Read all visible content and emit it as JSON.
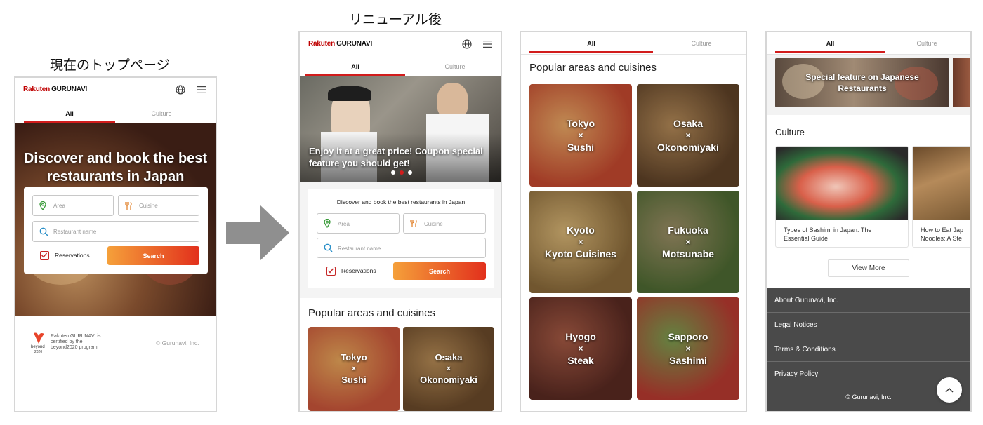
{
  "captions": {
    "current": "現在のトップページ",
    "renewal": "リニューアル後"
  },
  "header": {
    "logo_brand": "Rakuten",
    "logo_product": "GURUNAVI"
  },
  "tabs": {
    "all": "All",
    "culture": "Culture"
  },
  "screen1": {
    "hero_title_line1": "Discover and book the best",
    "hero_title_line2": "restaurants in Japan",
    "area_placeholder": "Area",
    "cuisine_placeholder": "Cuisine",
    "restaurant_placeholder": "Restaurant name",
    "reservations_label": "Reservations",
    "search_label": "Search",
    "footer_text_line1": "Rakuten GURUNAVI is",
    "footer_text_line2": "certified by the",
    "footer_text_line3": "beyond2020 program.",
    "beyond_logo_line1": "beyond",
    "beyond_logo_line2": "2020",
    "copyright": "© Gurunavi, Inc."
  },
  "screen2": {
    "banner_line1": "Enjoy it at a great price! Coupon special",
    "banner_line2": "feature you should get!",
    "search_heading": "Discover and book the best restaurants in Japan",
    "area_placeholder": "Area",
    "cuisine_placeholder": "Cuisine",
    "restaurant_placeholder": "Restaurant name",
    "reservations_label": "Reservations",
    "search_label": "Search",
    "popular_title": "Popular areas and cuisines",
    "tiles": [
      {
        "city": "Tokyo",
        "sep": "×",
        "food": "Sushi",
        "color1": "#c9553a",
        "color2": "#e8a65a"
      },
      {
        "city": "Osaka",
        "sep": "×",
        "food": "Okonomiyaki",
        "color1": "#6b4a2a",
        "color2": "#b58a55"
      }
    ]
  },
  "screen3": {
    "popular_title": "Popular areas and cuisines",
    "tiles": [
      {
        "city": "Tokyo",
        "sep": "×",
        "food": "Sushi",
        "color1": "#c4492f",
        "color2": "#eaa865"
      },
      {
        "city": "Osaka",
        "sep": "×",
        "food": "Okonomiyaki",
        "color1": "#5e4127",
        "color2": "#b48a58"
      },
      {
        "city": "Kyoto",
        "sep": "×",
        "food": "Kyoto Cuisines",
        "color1": "#8a6a3a",
        "color2": "#d9b676"
      },
      {
        "city": "Fukuoka",
        "sep": "×",
        "food": "Motsunabe",
        "color1": "#4e6a32",
        "color2": "#9c8e66"
      },
      {
        "city": "Hyogo",
        "sep": "×",
        "food": "Steak",
        "color1": "#5a2a22",
        "color2": "#a65a44"
      },
      {
        "city": "Sapporo",
        "sep": "×",
        "food": "Sashimi",
        "color1": "#b83a30",
        "color2": "#7aa050"
      }
    ]
  },
  "screen4": {
    "special_line1": "Special feature on Japanese",
    "special_line2": "Restaurants",
    "culture_title": "Culture",
    "card1_line1": "Types of Sashimi in Japan: The",
    "card1_line2": "Essential Guide",
    "card2_line1": "How to Eat Jap",
    "card2_line2": "Noodles: A Ste",
    "view_more": "View More",
    "footer_links": [
      "About Gurunavi, Inc.",
      "Legal Notices",
      "Terms & Conditions",
      "Privacy Policy"
    ],
    "copyright": "© Gurunavi, Inc."
  },
  "colors": {
    "brand_red": "#bf0000",
    "tab_underline": "#d21c1c",
    "search_gradient_start": "#f5a03a",
    "search_gradient_end": "#e2301c",
    "footer_bg": "#4a4a4a"
  }
}
